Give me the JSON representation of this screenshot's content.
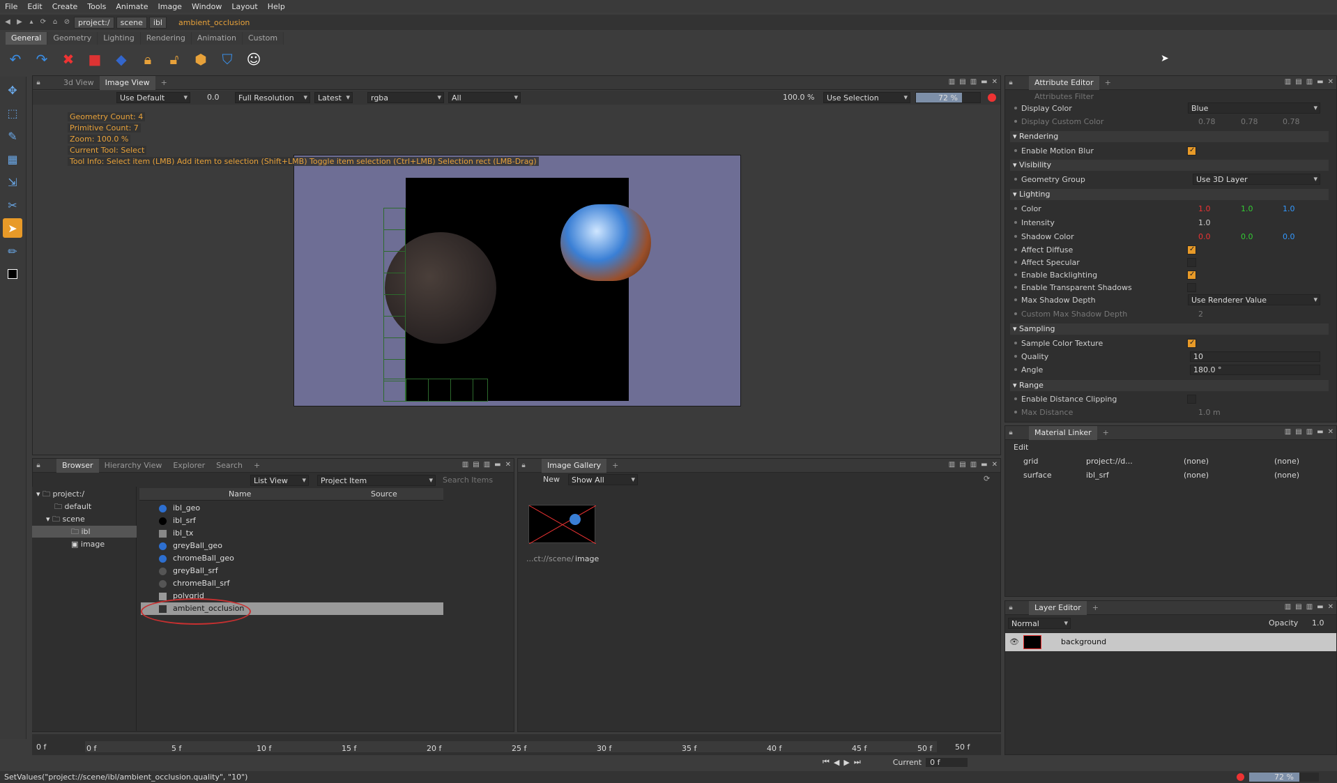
{
  "menu": [
    "File",
    "Edit",
    "Create",
    "Tools",
    "Animate",
    "Image",
    "Window",
    "Layout",
    "Help"
  ],
  "path": {
    "crumbs": [
      "project:/",
      "scene",
      "ibl"
    ],
    "current": "ambient_occlusion"
  },
  "shelf_tabs": [
    "General",
    "Geometry",
    "Lighting",
    "Rendering",
    "Animation",
    "Custom"
  ],
  "viewer": {
    "tabs": [
      "3d View",
      "Image View"
    ],
    "toolbar": {
      "preset": "Use Default",
      "exposure": "0.0",
      "resolution": "Full Resolution",
      "version": "Latest",
      "channels": "rgba",
      "layers": "All",
      "zoom": "100.0 %",
      "selection_mode": "Use Selection",
      "progress": "72 %"
    },
    "hud": [
      "Geometry Count: 4",
      "Primitive Count: 7",
      "Zoom: 100.0 %",
      "Current Tool: Select",
      "Tool Info: Select item (LMB)  Add item to selection (Shift+LMB)  Toggle item selection (Ctrl+LMB)  Selection rect (LMB-Drag)"
    ]
  },
  "attr_editor": {
    "tab": "Attribute Editor",
    "filter_placeholder": "Attributes Filter",
    "display_color_label": "Display Color",
    "display_color_value": "Blue",
    "display_custom_color_label": "Display Custom Color",
    "display_custom_color_values": [
      "0.78",
      "0.78",
      "0.78"
    ],
    "sections": {
      "rendering": "Rendering",
      "visibility": "Visibility",
      "lighting": "Lighting",
      "sampling": "Sampling",
      "range": "Range"
    },
    "enable_motion_blur": "Enable Motion Blur",
    "geometry_group": "Geometry Group",
    "geometry_group_value": "Use 3D Layer",
    "color": "Color",
    "color_values": [
      "1.0",
      "1.0",
      "1.0"
    ],
    "intensity": "Intensity",
    "intensity_value": "1.0",
    "shadow_color": "Shadow Color",
    "shadow_values": [
      "0.0",
      "0.0",
      "0.0"
    ],
    "affect_diffuse": "Affect Diffuse",
    "affect_specular": "Affect Specular",
    "enable_backlighting": "Enable Backlighting",
    "enable_transparent_shadows": "Enable Transparent Shadows",
    "max_shadow_depth": "Max Shadow Depth",
    "max_shadow_depth_value": "Use Renderer Value",
    "custom_max_shadow_depth": "Custom Max Shadow Depth",
    "custom_max_shadow_depth_value": "2",
    "sample_color_texture": "Sample Color Texture",
    "quality": "Quality",
    "quality_value": "10",
    "angle": "Angle",
    "angle_value": "180.0 °",
    "enable_distance_clipping": "Enable Distance Clipping",
    "max_distance": "Max Distance",
    "max_distance_value": "1.0 m",
    "accent": "#e89a28"
  },
  "material_linker": {
    "tab": "Material Linker",
    "edit": "Edit",
    "rows": [
      {
        "name": "grid",
        "link": "project://d...",
        "a": "(none)",
        "b": "(none)"
      },
      {
        "name": "surface",
        "link": "ibl_srf",
        "a": "(none)",
        "b": "(none)"
      }
    ]
  },
  "layer_editor": {
    "tab": "Layer Editor",
    "blend": "Normal",
    "opacity_label": "Opacity",
    "opacity": "1.0",
    "layer": "background"
  },
  "browser": {
    "tabs": [
      "Browser",
      "Hierarchy View",
      "Explorer",
      "Search"
    ],
    "view": "List View",
    "filter": "Project Item",
    "search_placeholder": "Search Items",
    "tree": [
      "project:/",
      "default",
      "scene",
      "ibl",
      "image"
    ],
    "columns": [
      "Name",
      "Source"
    ],
    "items": [
      "ibl_geo",
      "ibl_srf",
      "ibl_tx",
      "greyBall_geo",
      "chromeBall_geo",
      "greyBall_srf",
      "chromeBall_srf",
      "polygrid",
      "ambient_occlusion"
    ]
  },
  "gallery": {
    "tab": "Image Gallery",
    "new": "New",
    "show": "Show All",
    "caption_prefix": "...ct://scene/",
    "caption_name": "image"
  },
  "timeline": {
    "start": "0 f",
    "end": "50 f",
    "ticks": [
      "0 f",
      "5 f",
      "10 f",
      "15 f",
      "20 f",
      "25 f",
      "30 f",
      "35 f",
      "40 f",
      "45 f",
      "50 f"
    ],
    "current_label": "Current",
    "current": "0 f"
  },
  "status": {
    "text": "SetValues(\"project://scene/ibl/ambient_occlusion.quality\", \"10\")",
    "progress": "72 %"
  }
}
